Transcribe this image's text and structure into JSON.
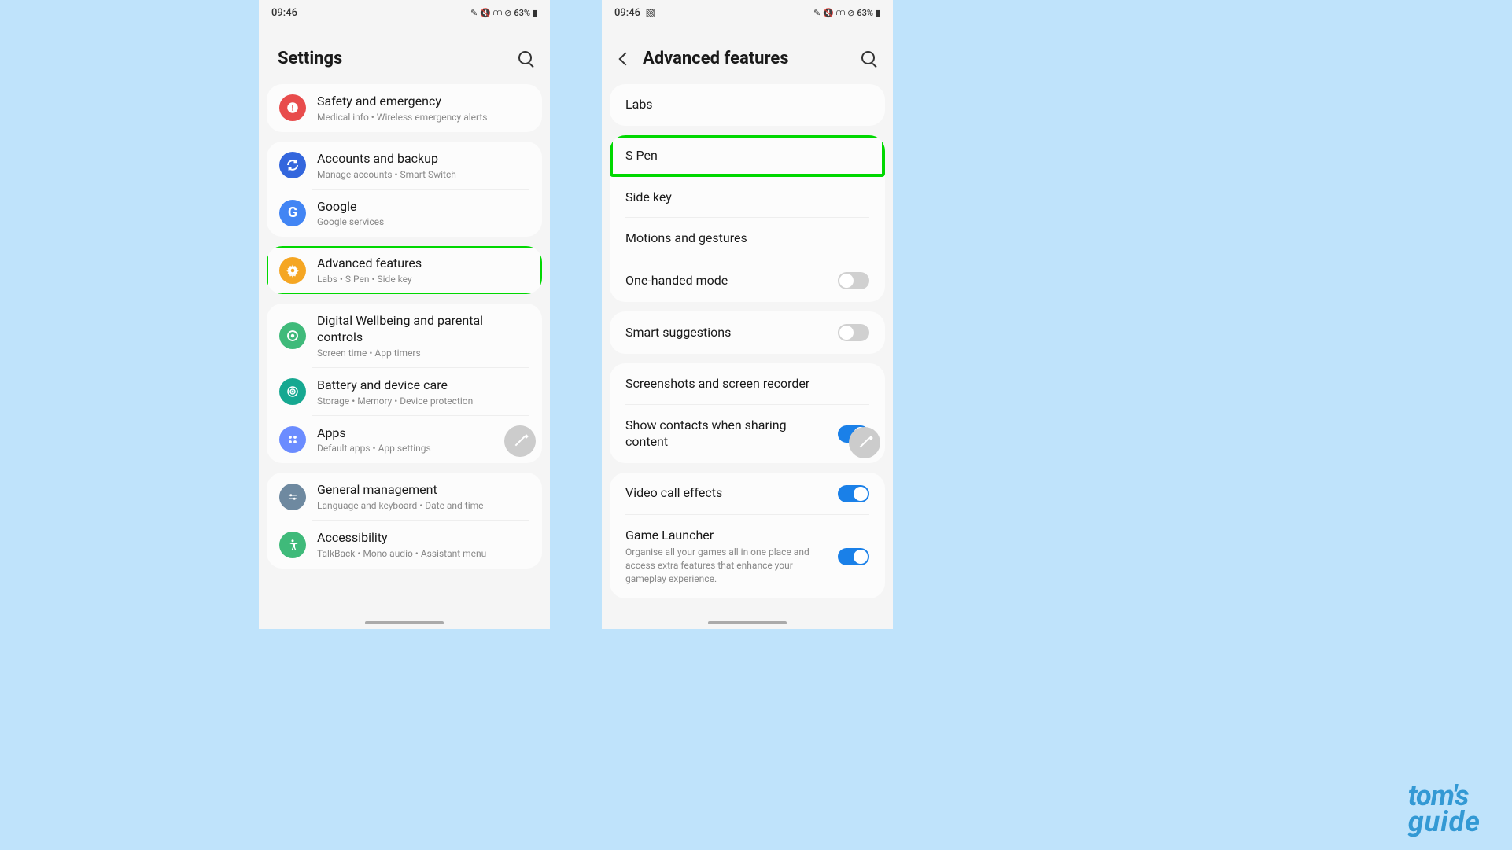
{
  "status": {
    "time": "09:46",
    "battery": "63%",
    "icons_unicode": "✎ ✕ ⟳ ⊘"
  },
  "left": {
    "title": "Settings",
    "items": [
      {
        "title": "Safety and emergency",
        "sub": "Medical info  •  Wireless emergency alerts",
        "icon_bg": "#e84c4c",
        "icon": "safety"
      },
      {
        "title": "Accounts and backup",
        "sub": "Manage accounts  •  Smart Switch",
        "icon_bg": "#3366dd",
        "icon": "sync"
      },
      {
        "title": "Google",
        "sub": "Google services",
        "icon_bg": "#4285f4",
        "icon": "google"
      },
      {
        "title": "Advanced features",
        "sub": "Labs  •  S Pen  •  Side key",
        "icon_bg": "#f5a623",
        "icon": "gear",
        "highlighted": true
      },
      {
        "title": "Digital Wellbeing and parental controls",
        "sub": "Screen time  •  App timers",
        "icon_bg": "#3fba7a",
        "icon": "wellbeing"
      },
      {
        "title": "Battery and device care",
        "sub": "Storage  •  Memory  •  Device protection",
        "icon_bg": "#16a891",
        "icon": "care"
      },
      {
        "title": "Apps",
        "sub": "Default apps  •  App settings",
        "icon_bg": "#6b8cff",
        "icon": "apps"
      },
      {
        "title": "General management",
        "sub": "Language and keyboard  •  Date and time",
        "icon_bg": "#6e89a0",
        "icon": "general"
      },
      {
        "title": "Accessibility",
        "sub": "TalkBack  •  Mono audio  •  Assistant menu",
        "icon_bg": "#3fba7a",
        "icon": "accessibility"
      }
    ]
  },
  "right": {
    "title": "Advanced features",
    "groups": [
      [
        {
          "title": "Labs"
        }
      ],
      [
        {
          "title": "S Pen",
          "highlighted": true
        },
        {
          "title": "Side key"
        },
        {
          "title": "Motions and gestures"
        },
        {
          "title": "One-handed mode",
          "toggle": "off"
        }
      ],
      [
        {
          "title": "Smart suggestions",
          "toggle": "off"
        }
      ],
      [
        {
          "title": "Screenshots and screen recorder"
        },
        {
          "title": "Show contacts when sharing content",
          "toggle": "on"
        }
      ],
      [
        {
          "title": "Video call effects",
          "toggle": "on"
        },
        {
          "title": "Game Launcher",
          "sub": "Organise all your games all in one place and access extra features that enhance your gameplay experience.",
          "toggle": "on"
        }
      ]
    ]
  },
  "watermark": {
    "line1": "tom's",
    "line2": "guide"
  }
}
